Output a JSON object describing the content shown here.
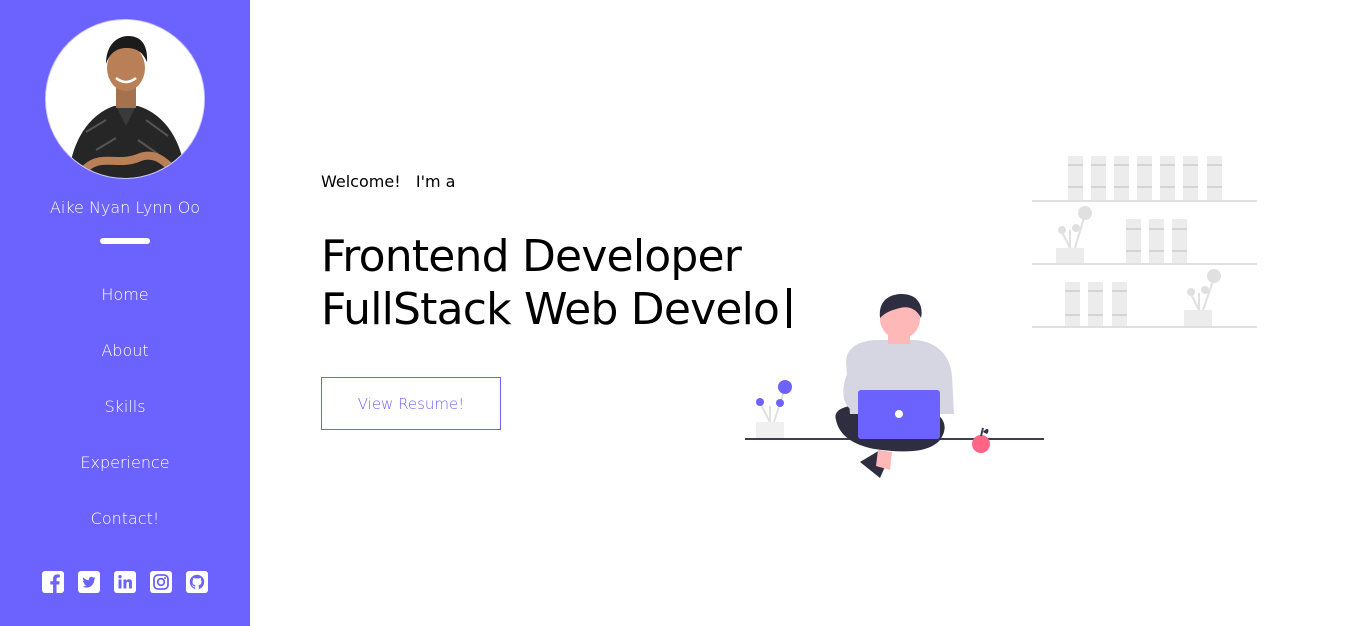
{
  "sidebar": {
    "owner_name": "Aike Nyan Lynn Oo",
    "nav": [
      {
        "label": "Home"
      },
      {
        "label": "About"
      },
      {
        "label": "Skills"
      },
      {
        "label": "Experience"
      },
      {
        "label": "Contact!"
      }
    ],
    "social_icons": [
      "facebook-square-icon",
      "twitter-square-icon",
      "linkedin-square-icon",
      "instagram-square-icon",
      "github-square-icon"
    ]
  },
  "hero": {
    "welcome": "Welcome!",
    "intro": "I'm a",
    "line1": "Frontend Developer",
    "line2": "FullStack Web Develo",
    "resume_button": "View Resume!"
  },
  "colors": {
    "accent": "#6c63ff",
    "sidebar_bg": "#6c63ff",
    "text": "#000000",
    "illustration_gray": "#e6e6e6",
    "illustration_dark": "#2f2e41",
    "illustration_pink": "#ff6584",
    "skin": "#ffb8b8"
  }
}
